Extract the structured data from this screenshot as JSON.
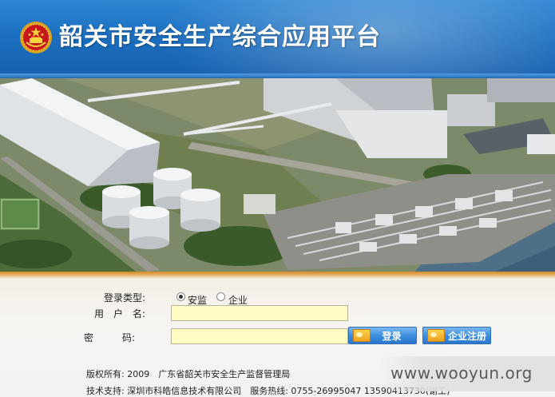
{
  "header": {
    "title": "韶关市安全生产综合应用平台",
    "emblem_icon": "national-emblem-icon"
  },
  "photo": {
    "description_icon": "industrial-aerial-photo"
  },
  "login": {
    "login_type_label": "登录类型:",
    "login_types": [
      {
        "label": "安监",
        "checked": true
      },
      {
        "label": "企业",
        "checked": false
      }
    ],
    "username_label": "用　户　名:",
    "username_value": "",
    "password_label": "密　　　码:",
    "password_value": "",
    "login_button_label": "登录",
    "register_button_label": "企业注册"
  },
  "footer": {
    "copyright": "版权所有: 2009　广东省韶关市安全生产监督管理局",
    "support": "技术支持: 深圳市科皓信息技术有限公司　服务热线: 0755-26995047 13590413730(谢工)"
  },
  "watermark": "www.wooyun.org",
  "colors": {
    "header_blue": "#1c6fc0",
    "input_yellow": "#fffcc4",
    "button_blue": "#3e8fe0",
    "orange_rule": "#d28a28"
  }
}
